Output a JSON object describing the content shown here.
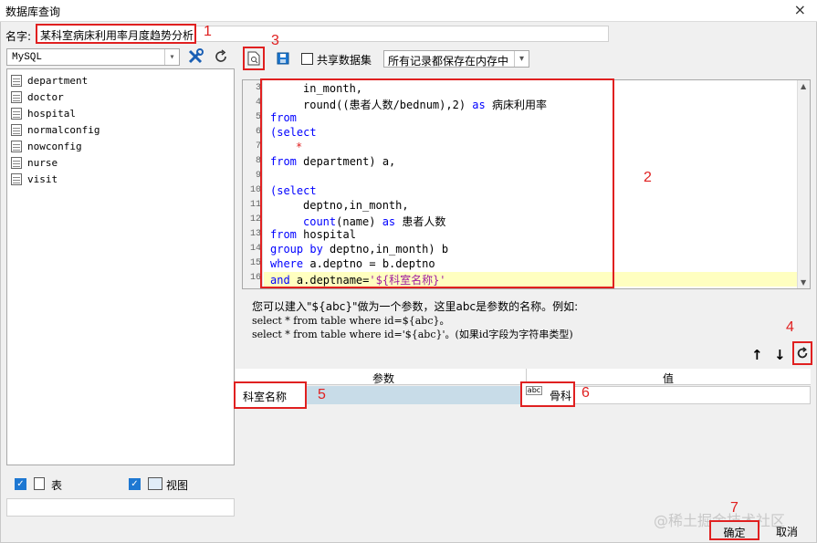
{
  "window": {
    "title": "数据库查询",
    "close_glyph": "×"
  },
  "name_row": {
    "label": "名字:",
    "value": "某科室病床利用率月度趋势分析"
  },
  "datasource": {
    "selected": "MySQL"
  },
  "toolbar": {
    "share_label": "共享数据集",
    "storage_selected": "所有记录都保存在内存中"
  },
  "tables": [
    "department",
    "doctor",
    "hospital",
    "normalconfig",
    "nowconfig",
    "nurse",
    "visit"
  ],
  "editor": {
    "lines": [
      {
        "n": "3",
        "text": "in_month,"
      },
      {
        "n": "4",
        "text": "round((患者人数/bednum),2) as 病床利用率"
      },
      {
        "n": "5",
        "text": "from"
      },
      {
        "n": "6",
        "text": "(select"
      },
      {
        "n": "7",
        "text": "*"
      },
      {
        "n": "8",
        "text": "from department) a,"
      },
      {
        "n": "9",
        "text": ""
      },
      {
        "n": "10",
        "text": "(select"
      },
      {
        "n": "11",
        "text": "deptno,in_month,"
      },
      {
        "n": "12",
        "text": "count(name) as 患者人数"
      },
      {
        "n": "13",
        "text": "from hospital"
      },
      {
        "n": "14",
        "text": "group by deptno,in_month) b"
      },
      {
        "n": "15",
        "text": "where a.deptno = b.deptno"
      },
      {
        "n": "16",
        "text": "and a.deptname='${科室名称}'"
      }
    ]
  },
  "hints": {
    "line1": "您可以建入\"${abc}\"做为一个参数，这里abc是参数的名称。例如:",
    "line2": "select * from table where id=${abc}。",
    "line3": "select * from table where id='${abc}'。(如果id字段为字符串类型)"
  },
  "param_grid": {
    "col_param": "参数",
    "col_value": "值",
    "param_name": "科室名称",
    "param_value": "骨科",
    "type_icon": "abc"
  },
  "bottom_checks": {
    "tables_label": "表",
    "views_label": "视图"
  },
  "buttons": {
    "ok": "确定",
    "cancel": "取消"
  },
  "markers": [
    "1",
    "2",
    "3",
    "4",
    "5",
    "6",
    "7"
  ],
  "watermark": "@稀土掘金技术社区",
  "colors": {
    "annotation_red": "#e02020",
    "keyword_blue": "#0000ff",
    "highlight": "#ffffc0"
  }
}
